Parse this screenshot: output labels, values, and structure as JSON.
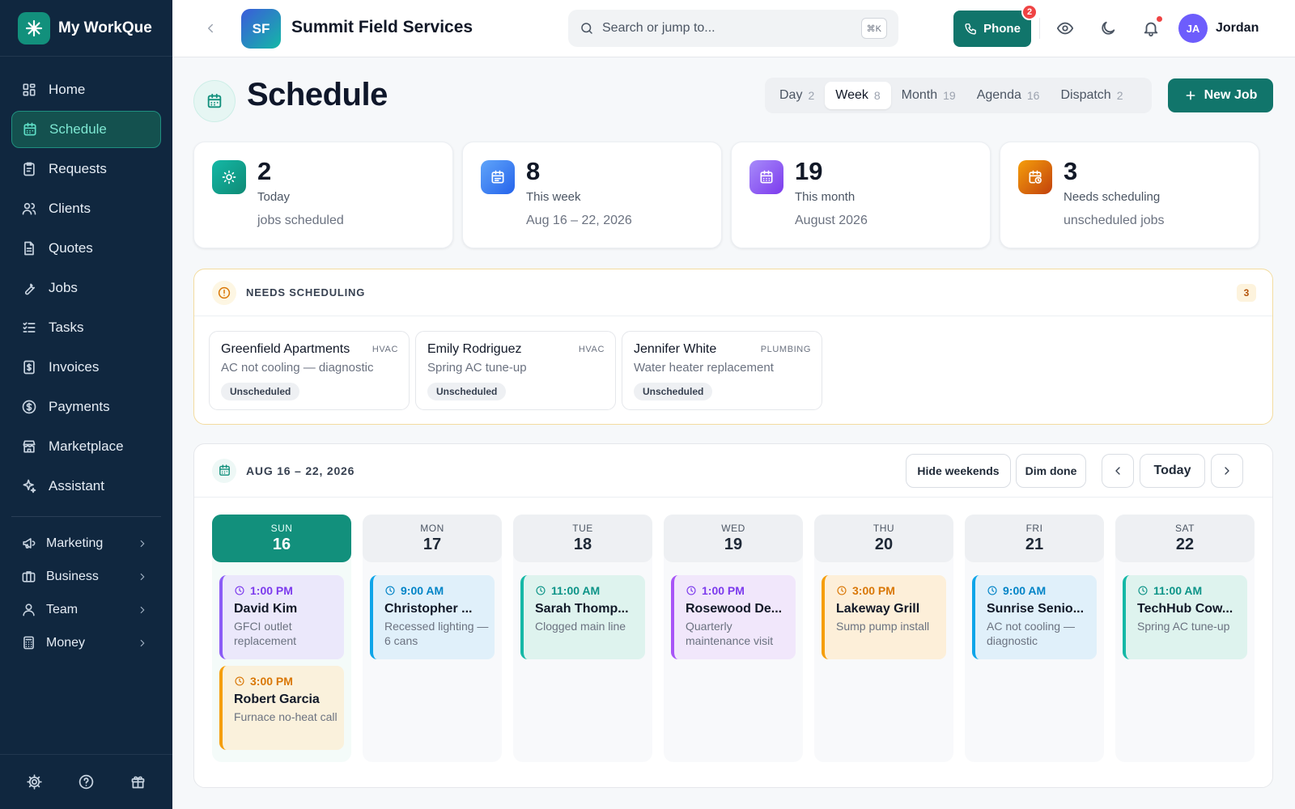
{
  "app": {
    "name": "My WorkQue"
  },
  "sidebar": {
    "items": [
      {
        "label": "Home",
        "icon": "grid-icon"
      },
      {
        "label": "Schedule",
        "icon": "calendar-icon",
        "active": true
      },
      {
        "label": "Requests",
        "icon": "clipboard-icon"
      },
      {
        "label": "Clients",
        "icon": "users-icon"
      },
      {
        "label": "Quotes",
        "icon": "document-icon"
      },
      {
        "label": "Jobs",
        "icon": "wrench-icon"
      },
      {
        "label": "Tasks",
        "icon": "checklist-icon"
      },
      {
        "label": "Invoices",
        "icon": "invoice-icon"
      },
      {
        "label": "Payments",
        "icon": "dollar-icon"
      },
      {
        "label": "Marketplace",
        "icon": "store-icon"
      },
      {
        "label": "Assistant",
        "icon": "sparkle-icon"
      }
    ],
    "groups": [
      {
        "label": "Marketing",
        "icon": "megaphone-icon"
      },
      {
        "label": "Business",
        "icon": "briefcase-icon"
      },
      {
        "label": "Team",
        "icon": "user-icon"
      },
      {
        "label": "Money",
        "icon": "calculator-icon"
      }
    ]
  },
  "topbar": {
    "org_initials": "SF",
    "org_name": "Summit Field Services",
    "search_placeholder": "Search or jump to...",
    "search_shortcut": "⌘K",
    "phone_label": "Phone",
    "phone_badge": "2",
    "user_initials": "JA",
    "user_name": "Jordan"
  },
  "page": {
    "title": "Schedule",
    "new_job_label": "New Job",
    "view_tabs": [
      {
        "label": "Day",
        "count": "2"
      },
      {
        "label": "Week",
        "count": "8",
        "active": true
      },
      {
        "label": "Month",
        "count": "19"
      },
      {
        "label": "Agenda",
        "count": "16"
      },
      {
        "label": "Dispatch",
        "count": "2"
      }
    ]
  },
  "stats": [
    {
      "value": "2",
      "label": "Today",
      "sub": "jobs scheduled",
      "icon": "sun-icon",
      "color": "#12907c"
    },
    {
      "value": "8",
      "label": "This week",
      "sub": "Aug 16 – 22, 2026",
      "icon": "calendar-icon",
      "color": "#3b82f6"
    },
    {
      "value": "19",
      "label": "This month",
      "sub": "August 2026",
      "icon": "calendar-icon",
      "color": "#8b5cf6"
    },
    {
      "value": "3",
      "label": "Needs scheduling",
      "sub": "unscheduled jobs",
      "icon": "calendar-clock-icon",
      "color": "#d97706"
    }
  ],
  "needs_scheduling": {
    "title": "NEEDS SCHEDULING",
    "count": "3",
    "items": [
      {
        "client": "Greenfield Apartments",
        "trade": "HVAC",
        "desc": "AC not cooling — diagnostic",
        "status": "Unscheduled"
      },
      {
        "client": "Emily Rodriguez",
        "trade": "HVAC",
        "desc": "Spring AC tune-up",
        "status": "Unscheduled"
      },
      {
        "client": "Jennifer White",
        "trade": "PLUMBING",
        "desc": "Water heater replacement",
        "status": "Unscheduled"
      }
    ]
  },
  "calendar": {
    "range": "AUG 16 – 22, 2026",
    "hide_weekends_label": "Hide weekends",
    "dim_done_label": "Dim done",
    "today_label": "Today",
    "days": [
      {
        "name": "SUN",
        "date": "16",
        "today": true,
        "jobs": [
          {
            "time": "1:00 PM",
            "client": "David Kim",
            "desc": "GFCI outlet replacement",
            "accent": "#8b5cf6",
            "bg": "#ebe8fb",
            "timecolor": "#7c3aed"
          },
          {
            "time": "3:00 PM",
            "client": "Robert Garcia",
            "desc": "Furnace no-heat call",
            "accent": "#f59e0b",
            "bg": "#faf1dc",
            "timecolor": "#d97706"
          }
        ]
      },
      {
        "name": "MON",
        "date": "17",
        "jobs": [
          {
            "time": "9:00 AM",
            "client": "Christopher ...",
            "desc": "Recessed lighting — 6 cans",
            "accent": "#0ea5e9",
            "bg": "#e0f0fa",
            "timecolor": "#0284c7"
          }
        ]
      },
      {
        "name": "TUE",
        "date": "18",
        "jobs": [
          {
            "time": "11:00 AM",
            "client": "Sarah Thomp...",
            "desc": "Clogged main line",
            "accent": "#14b8a6",
            "bg": "#def3ee",
            "timecolor": "#0d9488"
          }
        ]
      },
      {
        "name": "WED",
        "date": "19",
        "jobs": [
          {
            "time": "1:00 PM",
            "client": "Rosewood De...",
            "desc": "Quarterly maintenance visit",
            "accent": "#a855f7",
            "bg": "#f1e7fb",
            "timecolor": "#7c3aed"
          }
        ]
      },
      {
        "name": "THU",
        "date": "20",
        "jobs": [
          {
            "time": "3:00 PM",
            "client": "Lakeway Grill",
            "desc": "Sump pump install",
            "accent": "#f59e0b",
            "bg": "#fdefd9",
            "timecolor": "#d97706"
          }
        ]
      },
      {
        "name": "FRI",
        "date": "21",
        "jobs": [
          {
            "time": "9:00 AM",
            "client": "Sunrise Senio...",
            "desc": "AC not cooling — diagnostic",
            "accent": "#0ea5e9",
            "bg": "#e0f0fa",
            "timecolor": "#0284c7"
          }
        ]
      },
      {
        "name": "SAT",
        "date": "22",
        "jobs": [
          {
            "time": "11:00 AM",
            "client": "TechHub Cow...",
            "desc": "Spring AC tune-up",
            "accent": "#14b8a6",
            "bg": "#def3ee",
            "timecolor": "#0d9488"
          }
        ]
      }
    ]
  }
}
